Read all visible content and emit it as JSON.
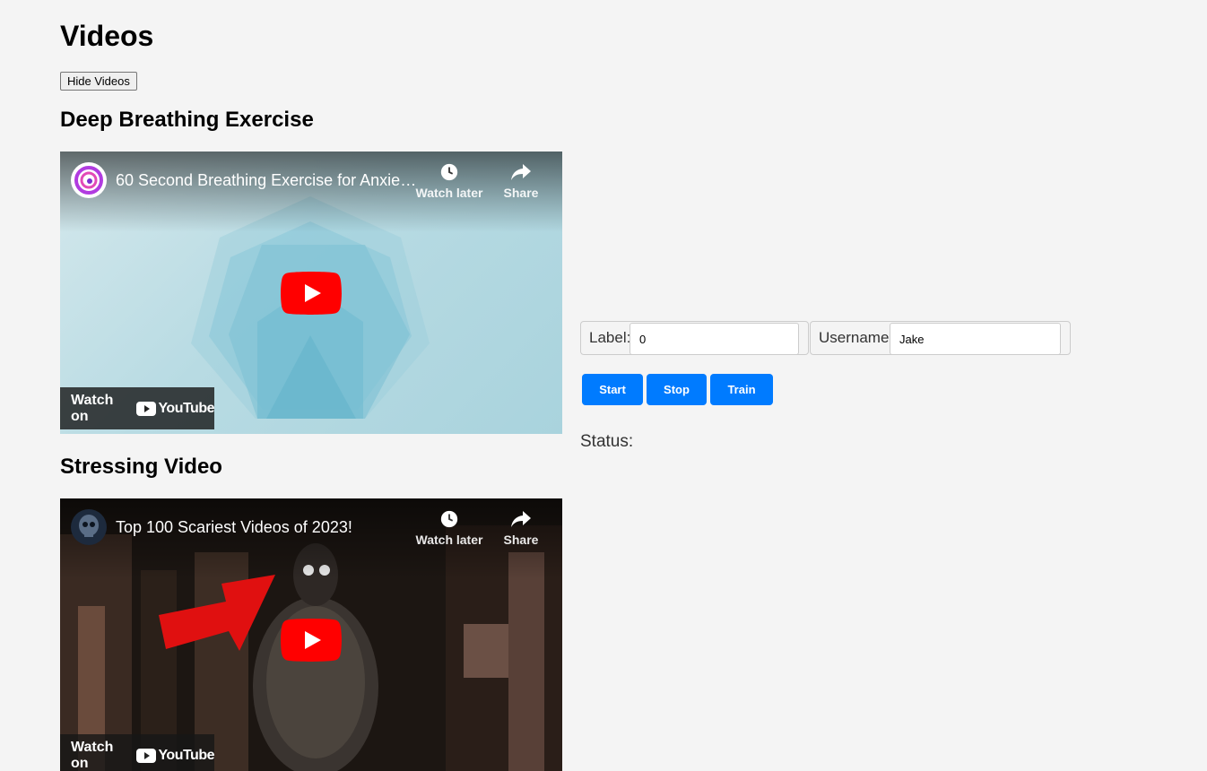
{
  "page": {
    "title": "Videos"
  },
  "toolbar": {
    "hide_videos_label": "Hide Videos"
  },
  "videos": [
    {
      "heading": "Deep Breathing Exercise",
      "title": "60 Second Breathing Exercise for Anxie…",
      "watch_later": "Watch later",
      "share": "Share",
      "watch_on": "Watch on",
      "youtube": "YouTube"
    },
    {
      "heading": "Stressing Video",
      "title": "Top 100 Scariest Videos of 2023!",
      "watch_later": "Watch later",
      "share": "Share",
      "watch_on": "Watch on",
      "youtube": "YouTube"
    }
  ],
  "form": {
    "label_field": {
      "label": "Label:",
      "value": "0"
    },
    "username_field": {
      "label": "Username:",
      "value": "Jake"
    }
  },
  "buttons": {
    "start": "Start",
    "stop": "Stop",
    "train": "Train"
  },
  "status": {
    "label": "Status:"
  },
  "colors": {
    "primary": "#007bff",
    "youtube_red": "#ff0000",
    "background": "#f4f4f4"
  }
}
